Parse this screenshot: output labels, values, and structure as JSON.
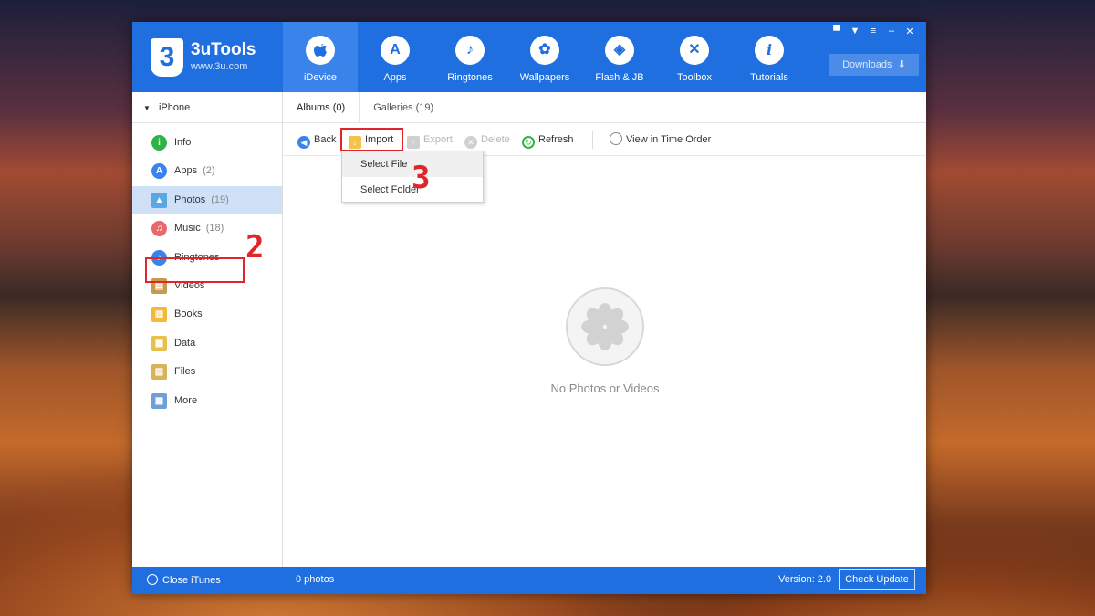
{
  "app": {
    "name": "3uTools",
    "url": "www.3u.com",
    "logo_glyph": "3",
    "accent": "#1f6fe0"
  },
  "nav": [
    {
      "label": "iDevice",
      "icon": "apple-icon",
      "glyph": "",
      "active": true
    },
    {
      "label": "Apps",
      "icon": "appstore-icon",
      "glyph": "A"
    },
    {
      "label": "Ringtones",
      "icon": "bell-icon",
      "glyph": "♪"
    },
    {
      "label": "Wallpapers",
      "icon": "flower-icon",
      "glyph": "✿"
    },
    {
      "label": "Flash & JB",
      "icon": "box-icon",
      "glyph": "◈"
    },
    {
      "label": "Toolbox",
      "icon": "tools-icon",
      "glyph": "✕"
    },
    {
      "label": "Tutorials",
      "icon": "info-icon",
      "glyph": "i"
    }
  ],
  "window_controls": {
    "feedback": "▀",
    "skin": "▼",
    "menu": "≡",
    "minimize": "–",
    "close": "✕"
  },
  "downloads_label": "Downloads",
  "device": {
    "name": "iPhone",
    "caret": "▼"
  },
  "sidebar": [
    {
      "label": "Info",
      "count": "",
      "icon": "info-icon",
      "glyph": "i",
      "color": "#2fb344"
    },
    {
      "label": "Apps",
      "count": "(2)",
      "icon": "appstore-icon",
      "glyph": "A",
      "color": "#3a83ea"
    },
    {
      "label": "Photos",
      "count": "(19)",
      "icon": "photo-icon",
      "glyph": "▲",
      "color": "#5aa7e6",
      "active": true
    },
    {
      "label": "Music",
      "count": "(18)",
      "icon": "music-icon",
      "glyph": "♫",
      "color": "#e8686b"
    },
    {
      "label": "Ringtones",
      "count": "",
      "icon": "bell-icon",
      "glyph": "♪",
      "color": "#3a83ea"
    },
    {
      "label": "Videos",
      "count": "",
      "icon": "film-icon",
      "glyph": "▤",
      "color": "#c99a4b"
    },
    {
      "label": "Books",
      "count": "",
      "icon": "book-icon",
      "glyph": "▥",
      "color": "#f2b93a"
    },
    {
      "label": "Data",
      "count": "",
      "icon": "data-icon",
      "glyph": "▦",
      "color": "#e7c04c"
    },
    {
      "label": "Files",
      "count": "",
      "icon": "file-icon",
      "glyph": "▧",
      "color": "#d9b25a"
    },
    {
      "label": "More",
      "count": "",
      "icon": "grid-icon",
      "glyph": "▦",
      "color": "#6f9fd8"
    }
  ],
  "tabs": [
    {
      "label": "Albums (0)",
      "active": true
    },
    {
      "label": "Galleries (19)"
    }
  ],
  "toolbar": {
    "back": "Back",
    "import": "Import",
    "export": "Export",
    "delete": "Delete",
    "refresh": "Refresh",
    "time_order": "View in Time Order"
  },
  "import_menu": [
    "Select File",
    "Select Folder"
  ],
  "empty_state": "No Photos or Videos",
  "status": {
    "close_itunes": "Close iTunes",
    "photo_count": "0 photos",
    "version": "Version: 2.0",
    "check_update": "Check Update"
  },
  "step_markers": {
    "photos": "2",
    "import": "3"
  }
}
